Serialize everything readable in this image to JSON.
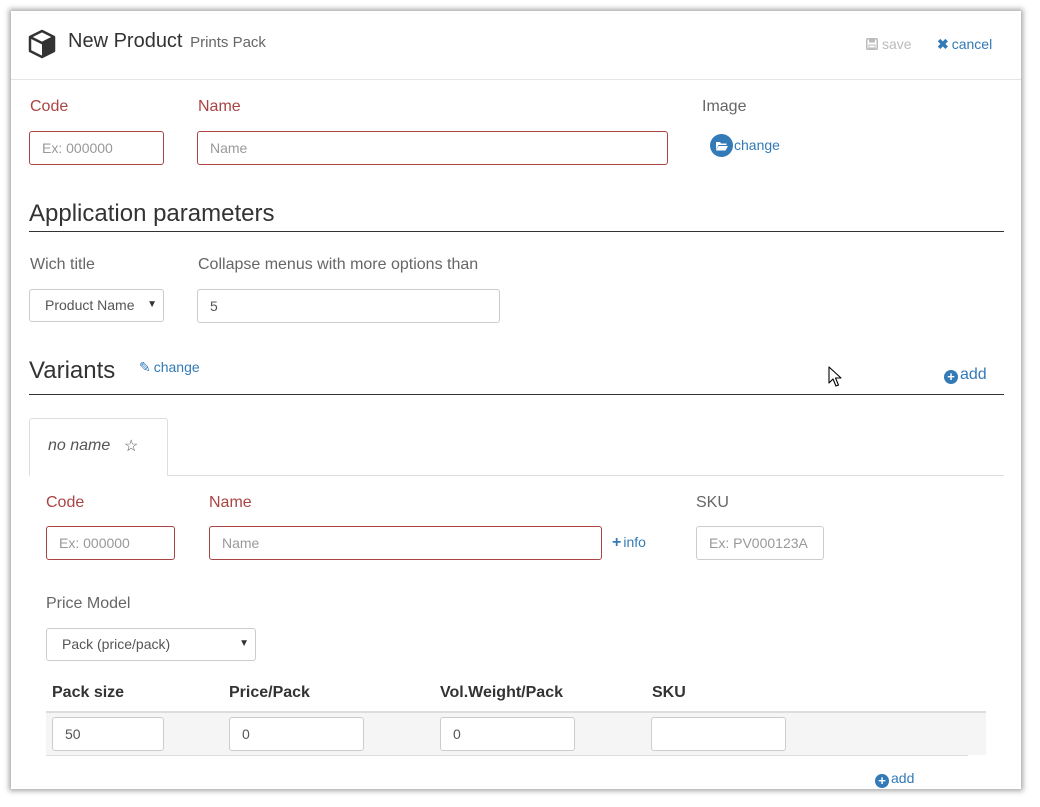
{
  "header": {
    "title": "New Product",
    "subtitle": "Prints Pack",
    "save_label": "save",
    "cancel_label": "cancel"
  },
  "product": {
    "code_label": "Code",
    "code_placeholder": "Ex: 000000",
    "name_label": "Name",
    "name_placeholder": "Name",
    "image_label": "Image",
    "image_change_label": "change"
  },
  "app_params": {
    "heading": "Application parameters",
    "which_title_label": "Wich title",
    "which_title_value": "Product Name",
    "collapse_label": "Collapse menus with more options than",
    "collapse_value": "5"
  },
  "variants": {
    "heading": "Variants",
    "change_label": "change",
    "add_label": "add",
    "tab_label": "no name",
    "code_label": "Code",
    "code_placeholder": "Ex: 000000",
    "name_label": "Name",
    "name_placeholder": "Name",
    "info_label": "info",
    "sku_label": "SKU",
    "sku_placeholder": "Ex: PV000123A",
    "price_model_label": "Price Model",
    "price_model_value": "Pack (price/pack)",
    "table": {
      "headers": [
        "Pack size",
        "Price/Pack",
        "Vol.Weight/Pack",
        "SKU"
      ],
      "row": [
        "50",
        "0",
        "0",
        ""
      ]
    },
    "table_add_label": "add"
  },
  "colors": {
    "required": "#a94442",
    "link": "#337ab7"
  }
}
